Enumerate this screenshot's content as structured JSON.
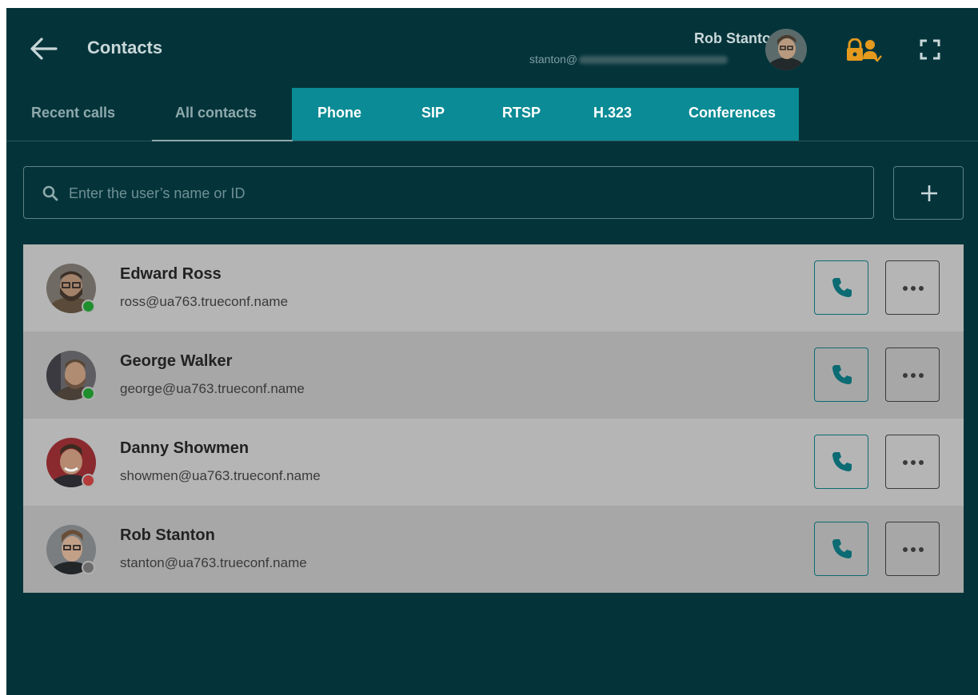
{
  "header": {
    "title": "Contacts",
    "user_name": "Rob Stanton",
    "user_email_visible": "stanton@",
    "lock_color": "#e59a1e"
  },
  "tabs": [
    {
      "label": "Recent calls",
      "active": false
    },
    {
      "label": "All contacts",
      "active": true
    },
    {
      "label": "Phone",
      "highlighted": true
    },
    {
      "label": "SIP",
      "highlighted": true
    },
    {
      "label": "RTSP",
      "highlighted": true
    },
    {
      "label": "H.323",
      "highlighted": true
    },
    {
      "label": "Conferences",
      "highlighted": true
    }
  ],
  "search": {
    "placeholder": "Enter the user’s name or ID",
    "value": ""
  },
  "contacts": [
    {
      "name": "Edward Ross",
      "email": "ross@ua763.trueconf.name",
      "status": "online",
      "status_color": "#1f8f2e"
    },
    {
      "name": "George Walker",
      "email": "george@ua763.trueconf.name",
      "status": "online",
      "status_color": "#1f8f2e"
    },
    {
      "name": "Danny Showmen",
      "email": "showmen@ua763.trueconf.name",
      "status": "busy",
      "status_color": "#b53a3a"
    },
    {
      "name": "Rob Stanton",
      "email": "stanton@ua763.trueconf.name",
      "status": "offline",
      "status_color": "#6c6c6c"
    }
  ],
  "colors": {
    "background": "#04343a",
    "highlight": "#0b8b95",
    "accent": "#0c6b73"
  }
}
